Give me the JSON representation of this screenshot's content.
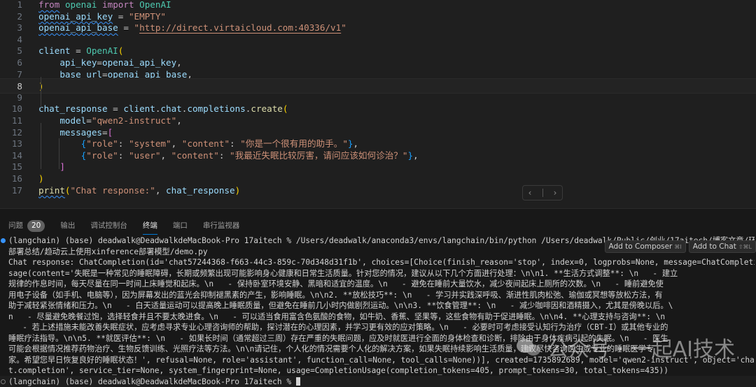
{
  "editor": {
    "lines": [
      {
        "n": "1",
        "tokens": [
          [
            "kw squig",
            "from"
          ],
          [
            "pun",
            " "
          ],
          [
            "cls",
            "openai"
          ],
          [
            "pun",
            " "
          ],
          [
            "kw",
            "import"
          ],
          [
            "pun",
            " "
          ],
          [
            "cls",
            "OpenAI"
          ]
        ]
      },
      {
        "n": "2",
        "tokens": [
          [
            "var squig",
            "openai_api_key"
          ],
          [
            "pun",
            " = "
          ],
          [
            "str",
            "\"EMPTY\""
          ]
        ]
      },
      {
        "n": "3",
        "tokens": [
          [
            "var squig",
            "openai_api_base"
          ],
          [
            "pun",
            " = "
          ],
          [
            "str",
            "\""
          ],
          [
            "str url",
            "http://direct.virtaicloud.com:40336/v1"
          ],
          [
            "str",
            "\""
          ]
        ]
      },
      {
        "n": "4",
        "tokens": []
      },
      {
        "n": "5",
        "tokens": [
          [
            "var",
            "client"
          ],
          [
            "pun",
            " = "
          ],
          [
            "cls",
            "OpenAI"
          ],
          [
            "br1",
            "("
          ]
        ]
      },
      {
        "n": "6",
        "tokens": [
          [
            "pun",
            "    "
          ],
          [
            "var",
            "api_key"
          ],
          [
            "pun",
            "="
          ],
          [
            "var",
            "openai_api_key"
          ],
          [
            "pun",
            ","
          ]
        ]
      },
      {
        "n": "7",
        "tokens": [
          [
            "pun",
            "    "
          ],
          [
            "var",
            "base_url"
          ],
          [
            "pun",
            "="
          ],
          [
            "var",
            "openai_api_base"
          ],
          [
            "pun",
            ","
          ]
        ]
      },
      {
        "n": "8",
        "tokens": [
          [
            "br1",
            ")"
          ]
        ]
      },
      {
        "n": "9",
        "tokens": []
      },
      {
        "n": "10",
        "tokens": [
          [
            "var",
            "chat_response"
          ],
          [
            "pun",
            " = "
          ],
          [
            "var",
            "client"
          ],
          [
            "pun",
            "."
          ],
          [
            "var",
            "chat"
          ],
          [
            "pun",
            "."
          ],
          [
            "var",
            "completions"
          ],
          [
            "pun",
            "."
          ],
          [
            "fn",
            "create"
          ],
          [
            "br1",
            "("
          ]
        ]
      },
      {
        "n": "11",
        "tokens": [
          [
            "pun",
            "    "
          ],
          [
            "var",
            "model"
          ],
          [
            "pun",
            "="
          ],
          [
            "str",
            "\"qwen2-instruct\""
          ],
          [
            "pun",
            ","
          ]
        ]
      },
      {
        "n": "12",
        "tokens": [
          [
            "pun",
            "    "
          ],
          [
            "var",
            "messages"
          ],
          [
            "pun",
            "="
          ],
          [
            "br2",
            "["
          ]
        ]
      },
      {
        "n": "13",
        "tokens": [
          [
            "pun",
            "        "
          ],
          [
            "br3",
            "{"
          ],
          [
            "str",
            "\"role\""
          ],
          [
            "pun",
            ": "
          ],
          [
            "str",
            "\"system\""
          ],
          [
            "pun",
            ", "
          ],
          [
            "str",
            "\"content\""
          ],
          [
            "pun",
            ": "
          ],
          [
            "str",
            "\"你是一个很有用的助手。\""
          ],
          [
            "br3",
            "}"
          ],
          [
            "pun",
            ","
          ]
        ]
      },
      {
        "n": "14",
        "tokens": [
          [
            "pun",
            "        "
          ],
          [
            "br3",
            "{"
          ],
          [
            "str",
            "\"role\""
          ],
          [
            "pun",
            ": "
          ],
          [
            "str",
            "\"user\""
          ],
          [
            "pun",
            ", "
          ],
          [
            "str",
            "\"content\""
          ],
          [
            "pun",
            ": "
          ],
          [
            "str",
            "\"我最近失眠比较厉害，请问应该如何诊治？\""
          ],
          [
            "br3",
            "}"
          ],
          [
            "pun",
            ","
          ]
        ]
      },
      {
        "n": "15",
        "tokens": [
          [
            "pun",
            "    "
          ],
          [
            "br2",
            "]"
          ]
        ]
      },
      {
        "n": "16",
        "tokens": [
          [
            "br1",
            ")"
          ]
        ]
      },
      {
        "n": "17",
        "tokens": [
          [
            "fn squig",
            "print"
          ],
          [
            "br1",
            "("
          ],
          [
            "str",
            "\"Chat response:\""
          ],
          [
            "pun",
            ", "
          ],
          [
            "var",
            "chat_response"
          ],
          [
            "br1",
            ")"
          ]
        ]
      }
    ],
    "active_line": "8",
    "nav_prev": "‹",
    "nav_next": "›"
  },
  "panel": {
    "tabs": [
      {
        "label": "问题",
        "badge": "20"
      },
      {
        "label": "输出"
      },
      {
        "label": "调试控制台"
      },
      {
        "label": "终端",
        "active": true
      },
      {
        "label": "端口"
      },
      {
        "label": "串行监视器"
      }
    ],
    "chat_buttons": [
      {
        "label": "Add to Composer",
        "shortcut": "⌘I"
      },
      {
        "label": "Add to Chat",
        "shortcut": "⇧⌘L"
      }
    ],
    "terminal_lines": [
      "(langchain) (base) deadwalk@DeadwalkdeMacBook-Pro 17aitech % /Users/deadwalk/anaconda3/envs/langchain/bin/python /Users/deadwalk/Public/创业/17aitech/博客文章/环境",
      "部署总结/趋动云上使用xinference部署模型/demo.py",
      "Chat response: ChatCompletion(id='chat57244368-f663-44c3-859c-70d348d31f1b', choices=[Choice(finish_reason='stop', index=0, logprobs=None, message=ChatCompletionMes",
      "sage(content='失眠是一种常见的睡眠障碍，长期或频繁出现可能影响身心健康和日常生活质量。针对您的情况，建议从以下几个方面进行处理：\\n\\n1. **生活方式调整**: \\n   - 建立",
      "规律的作息时间，每天尽量在同一时间上床睡觉和起床。\\n   - 保持卧室环境安静、黑暗和适宜的温度。\\n   - 避免在睡前大量饮水，减少夜间起床上厕所的次数。\\n   - 睡前避免使",
      "用电子设备（如手机、电脑等），因为屏幕发出的蓝光会抑制褪黑素的产生，影响睡眠。\\n\\n2. **放松技巧**: \\n   - 学习并实践深呼吸、渐进性肌肉松弛、瑜伽或冥想等放松方法，有",
      "助于减轻紧张情绪和压力。\\n   - 白天适量运动可以提高晚上睡眠质量，但避免在睡前几小时内做剧烈运动。\\n\\n3. **饮食管理**: \\n   - 减少咖啡因和酒精摄入，尤其是傍晚以后。\\",
      "n   - 尽量避免晚餐过饱，选择轻食并且不要太晚进食。\\n   - 可以适当食用富含色氨酸的食物，如牛奶、香蕉、坚果等，这些食物有助于促进睡眠。\\n\\n4. **心理支持与咨询**: \\n",
      "   - 若上述措施未能改善失眠症状，应考虑寻求专业心理咨询师的帮助，探讨潜在的心理因素，并学习更有效的应对策略。\\n   - 必要时可考虑接受认知行为治疗（CBT-I）或其他专业的",
      "睡眠疗法指导。\\n\\n5. **就医评估**: \\n   - 如果长时间（通常超过三周）存在严重的失眠问题，应及时就医进行全面的身体检查和诊断，排除由于身体疾病引起的失眠。\\n   - 医生",
      "可能会根据情况推荐药物治疗、生物反馈训练、光照疗法等方法。\\n\\n请记住，个人化的情况需要个人化的解决方案，如果失眠持续影响生活质量，建议尽快咨询医生或专业的睡眠医学专",
      "家。希望您早日恢复良好的睡眠状态！', refusal=None, role='assistant', function_call=None, tool_calls=None))], created=1735892689, model='qwen2-instruct', object='cha",
      "t.completion', service_tier=None, system_fingerprint=None, usage=CompletionUsage(completion_tokens=405, prompt_tokens=30, total_tokens=435))"
    ],
    "prompt_line": "(langchain) (base) deadwalk@DeadwalkdeMacBook-Pro 17aitech % "
  },
  "watermark": {
    "text": "公众号 · 一起AI技术"
  }
}
